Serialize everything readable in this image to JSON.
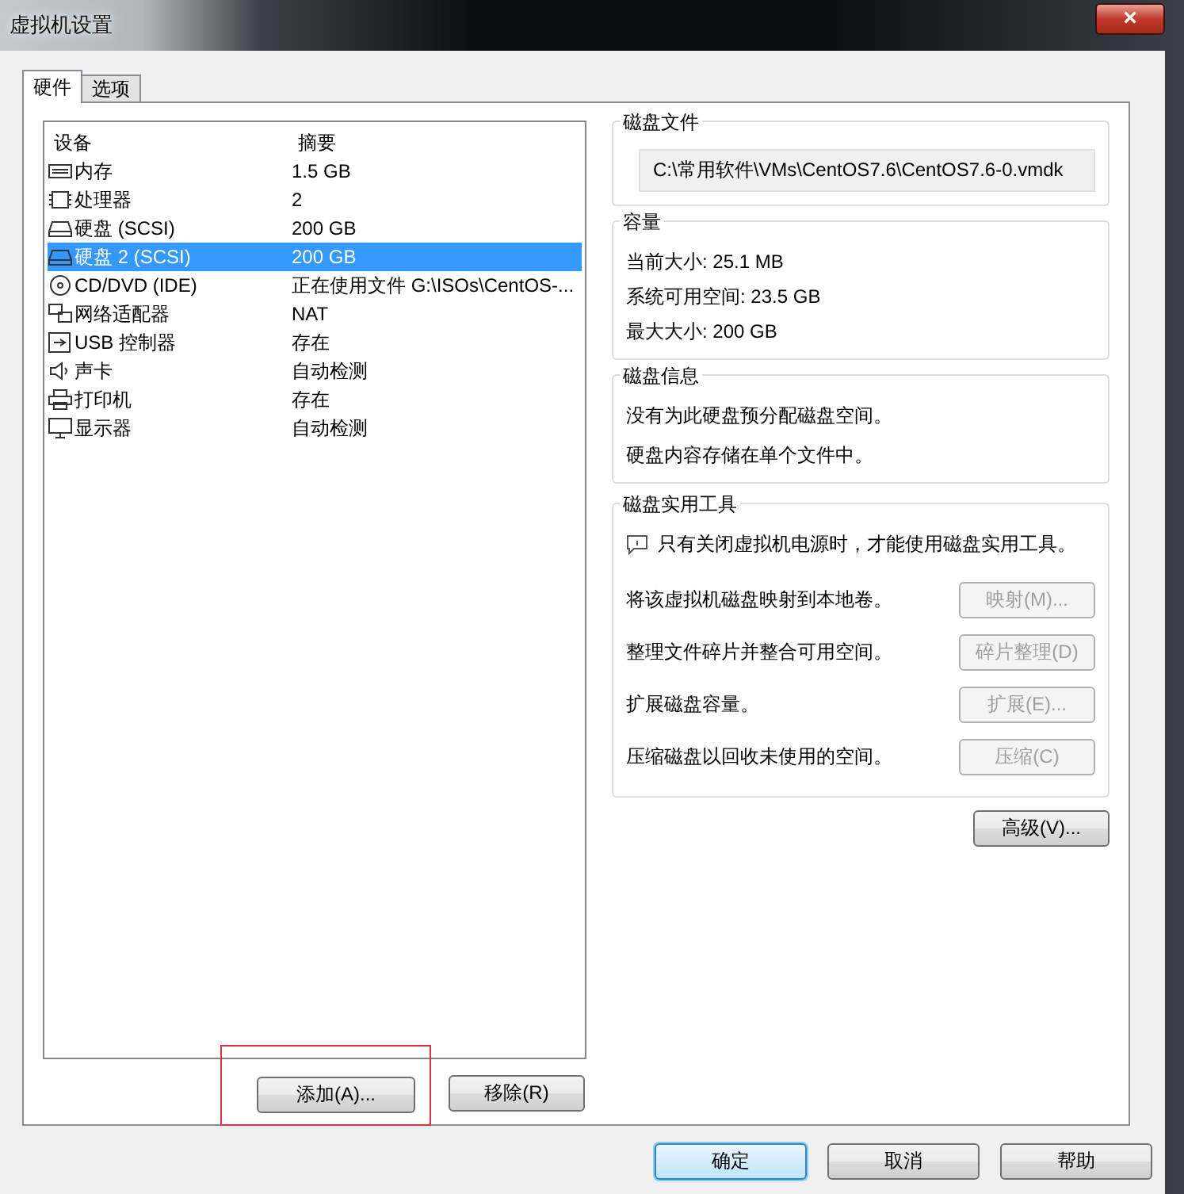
{
  "window": {
    "title": "虚拟机设置",
    "close": "×"
  },
  "tabs": [
    {
      "label": "硬件",
      "selected": true
    },
    {
      "label": "选项",
      "selected": false
    }
  ],
  "devices": {
    "columns": [
      "设备",
      "摘要"
    ],
    "rows": [
      {
        "kind": "memory",
        "name": "内存",
        "summary": "1.5 GB",
        "selected": false
      },
      {
        "kind": "cpu",
        "name": "处理器",
        "summary": "2",
        "selected": false
      },
      {
        "kind": "disk",
        "name": "硬盘 (SCSI)",
        "summary": "200 GB",
        "selected": false
      },
      {
        "kind": "disk",
        "name": "硬盘 2 (SCSI)",
        "summary": "200 GB",
        "selected": true
      },
      {
        "kind": "cd",
        "name": "CD/DVD (IDE)",
        "summary": "正在使用文件 G:\\ISOs\\CentOS-...",
        "selected": false
      },
      {
        "kind": "network",
        "name": "网络适配器",
        "summary": "NAT",
        "selected": false
      },
      {
        "kind": "usb",
        "name": "USB 控制器",
        "summary": "存在",
        "selected": false
      },
      {
        "kind": "sound",
        "name": "声卡",
        "summary": "自动检测",
        "selected": false
      },
      {
        "kind": "printer",
        "name": "打印机",
        "summary": "存在",
        "selected": false
      },
      {
        "kind": "display",
        "name": "显示器",
        "summary": "自动检测",
        "selected": false
      }
    ]
  },
  "list_buttons": [
    {
      "label": "添加(A)...",
      "highlighted": true
    },
    {
      "label": "移除(R)",
      "highlighted": false
    }
  ],
  "disk_file": {
    "title": "磁盘文件",
    "value": "C:\\常用软件\\VMs\\CentOS7.6\\CentOS7.6-0.vmdk"
  },
  "capacity": {
    "title": "容量",
    "lines": [
      "当前大小: 25.1 MB",
      "系统可用空间: 23.5 GB",
      "最大大小: 200 GB"
    ]
  },
  "disk_info": {
    "title": "磁盘信息",
    "lines": [
      "没有为此硬盘预分配磁盘空间。",
      "硬盘内容存储在单个文件中。"
    ]
  },
  "utilities": {
    "title": "磁盘实用工具",
    "note": "只有关闭虚拟机电源时，才能使用磁盘实用工具。",
    "actions": [
      {
        "text": "将该虚拟机磁盘映射到本地卷。",
        "button": "映射(M)...",
        "disabled": true
      },
      {
        "text": "整理文件碎片并整合可用空间。",
        "button": "碎片整理(D)",
        "disabled": true
      },
      {
        "text": "扩展磁盘容量。",
        "button": "扩展(E)...",
        "disabled": true
      },
      {
        "text": "压缩磁盘以回收未使用的空间。",
        "button": "压缩(C)",
        "disabled": true
      }
    ]
  },
  "advanced_button": "高级(V)...",
  "footer_buttons": [
    {
      "label": "确定",
      "default": true
    },
    {
      "label": "取消",
      "default": false
    },
    {
      "label": "帮助",
      "default": false
    }
  ]
}
